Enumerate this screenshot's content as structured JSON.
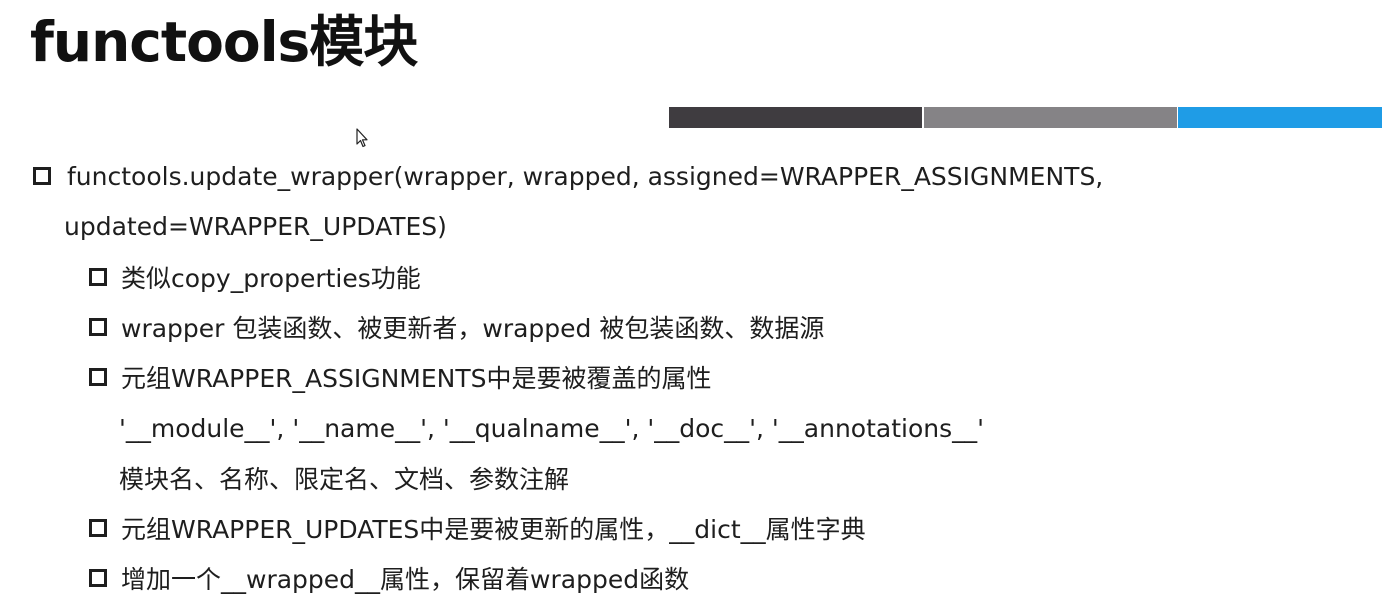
{
  "slide": {
    "title": "functools模块"
  },
  "decor": {
    "bar_colors": [
      "#3f3c40",
      "#858386",
      "#1f9ce6"
    ]
  },
  "bullets": {
    "main_line1": "functools.update_wrapper(wrapper, wrapped, assigned=WRAPPER_ASSIGNMENTS,",
    "main_line2": "updated=WRAPPER_UPDATES)",
    "sub1": "类似copy_properties功能",
    "sub2": "wrapper 包装函数、被更新者，wrapped 被包装函数、数据源",
    "sub3": "元组WRAPPER_ASSIGNMENTS中是要被覆盖的属性",
    "sub3_line2": "'__module__', '__name__', '__qualname__', '__doc__', '__annotations__'",
    "sub3_line3": "模块名、名称、限定名、文档、参数注解",
    "sub4": "元组WRAPPER_UPDATES中是要被更新的属性，__dict__属性字典",
    "sub5": "增加一个__wrapped__属性，保留着wrapped函数"
  },
  "icons": {
    "bullet": "square-bullet-icon",
    "cursor": "mouse-pointer-icon"
  }
}
